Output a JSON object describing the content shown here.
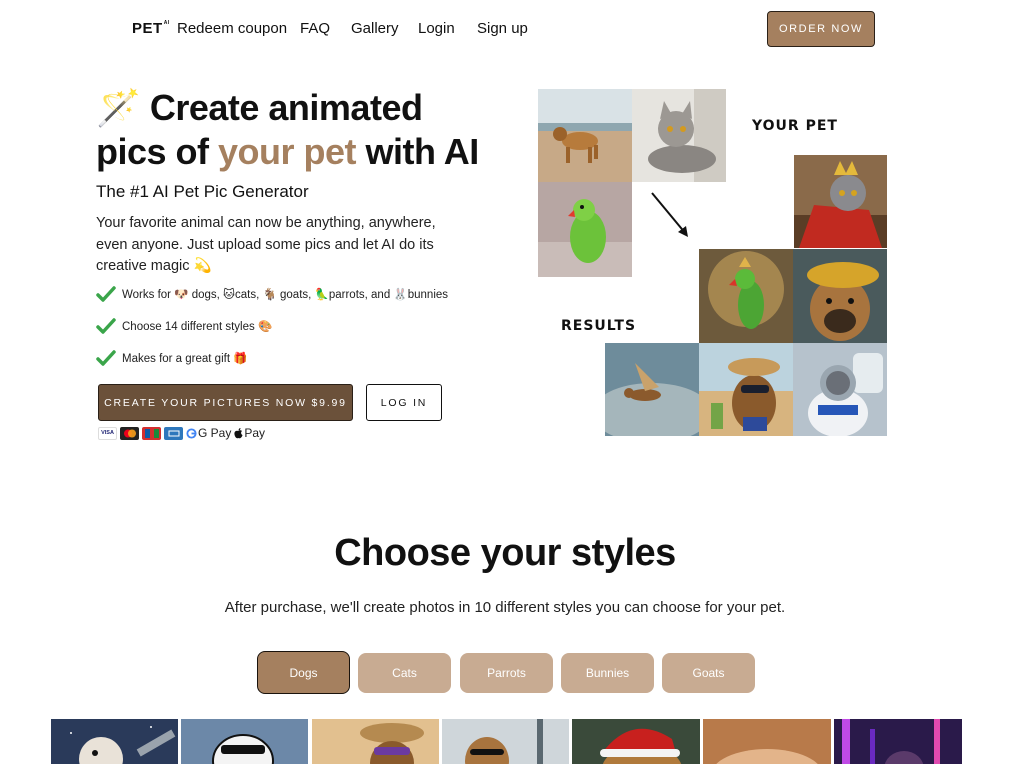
{
  "nav": {
    "logo": "PET",
    "logo_small": "AI",
    "links": [
      "Redeem coupon",
      "FAQ",
      "Gallery",
      "Login",
      "Sign up"
    ],
    "order_button": "ORDER NOW"
  },
  "hero": {
    "emoji": "🪄",
    "title_line1": "Create animated",
    "title_pics": "pics of ",
    "title_accent": "your pet",
    "title_end": " with AI",
    "subtitle": "The #1 AI Pet Pic Generator",
    "description": "Your favorite animal can now be anything, anywhere, even anyone. Just upload some pics and let AI do its creative magic 💫",
    "features": [
      "Works for 🐶 dogs, 🐱cats, 🐐 goats, 🦜parrots, and 🐰bunnies",
      "Choose 14 different styles 🎨",
      "Makes for a great gift 🎁"
    ],
    "cta_button": "CREATE YOUR PICTURES NOW $9.99",
    "login_button": "LOG IN",
    "payment": {
      "gpay": "G Pay",
      "applepay": "Pay",
      "visa": "VISA"
    }
  },
  "collage": {
    "your_pet_label": "YOUR PET",
    "results_label": "RESULTS"
  },
  "styles": {
    "title": "Choose your styles",
    "subtitle": "After purchase, we'll create photos in 10 different styles you can choose for your pet.",
    "tabs": [
      "Dogs",
      "Cats",
      "Parrots",
      "Bunnies",
      "Goats"
    ],
    "active_tab": "Dogs"
  },
  "colors": {
    "accent": "#a5805f",
    "dark_brown": "#6b513a",
    "tab_inactive": "#c8ab92",
    "check_green": "#3aa54a"
  }
}
